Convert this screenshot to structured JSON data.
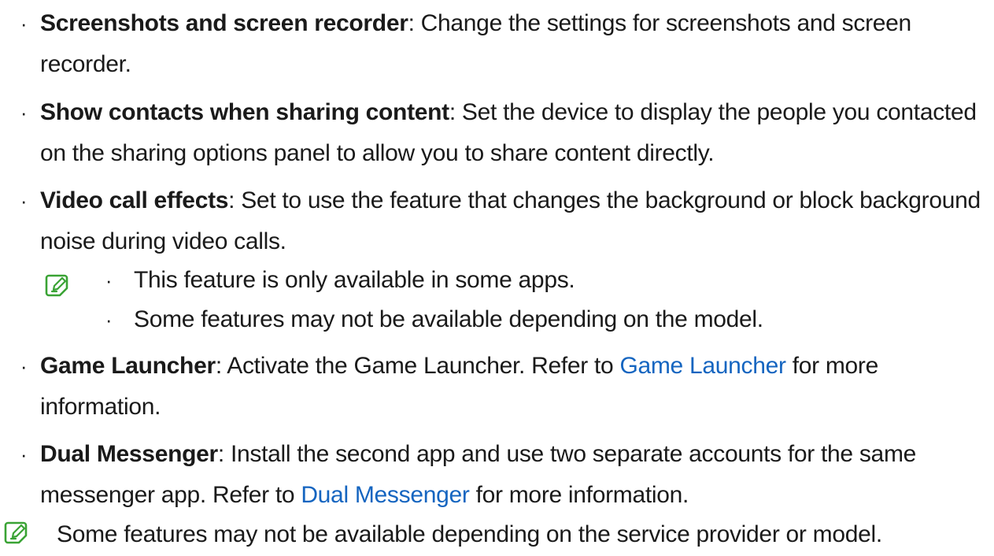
{
  "bullet_glyph": "·",
  "items": [
    {
      "term": "Screenshots and screen recorder",
      "text": ": Change the settings for screenshots and screen recorder."
    },
    {
      "term": "Show contacts when sharing content",
      "text": ": Set the device to display the people you contacted on the sharing options panel to allow you to share content directly."
    },
    {
      "term": "Video call effects",
      "text": ": Set to use the feature that changes the background or block background noise during video calls."
    },
    {
      "term": "Game Launcher",
      "text_before": ": Activate the Game Launcher. Refer to ",
      "link": "Game Launcher",
      "text_after": " for more information."
    },
    {
      "term": "Dual Messenger",
      "text_before": ": Install the second app and use two separate accounts for the same messenger app. Refer to ",
      "link": "Dual Messenger",
      "text_after": " for more information."
    }
  ],
  "note_items": [
    "This feature is only available in some apps.",
    "Some features may not be available depending on the model."
  ],
  "footnote": "Some features may not be available depending on the service provider or model.",
  "colors": {
    "link": "#1565c0",
    "note_icon": "#3aa335"
  },
  "icons": {
    "note": "note-icon"
  }
}
